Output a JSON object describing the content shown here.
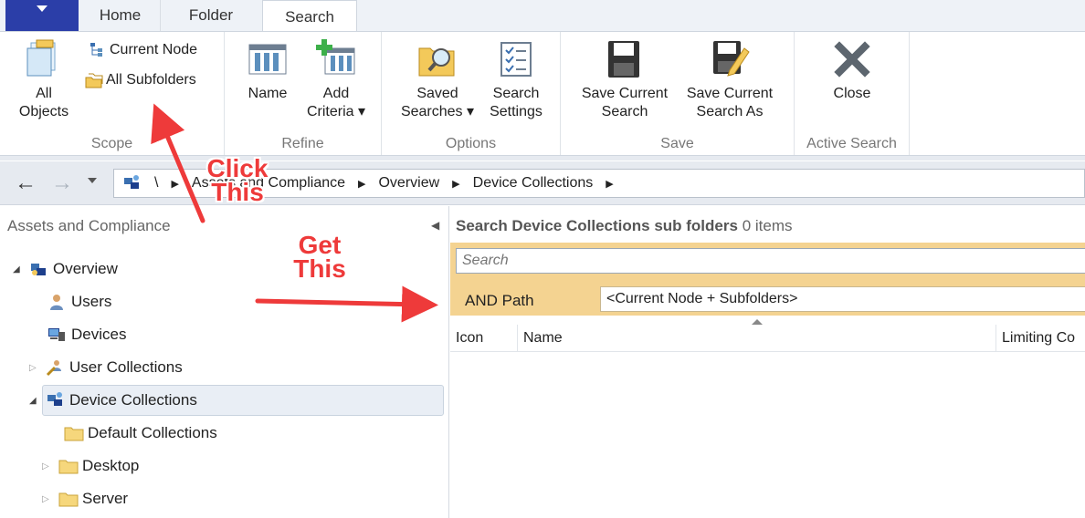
{
  "tabs": {
    "home": "Home",
    "folder": "Folder",
    "search": "Search"
  },
  "ribbon": {
    "scope": {
      "label": "Scope",
      "all_objects": "All\nObjects",
      "all_objects_l1": "All",
      "all_objects_l2": "Objects",
      "current_node": "Current Node",
      "all_subfolders": "All Subfolders"
    },
    "refine": {
      "label": "Refine",
      "name": "Name",
      "add_criteria_l1": "Add",
      "add_criteria_l2": "Criteria ▾"
    },
    "options": {
      "label": "Options",
      "saved_searches_l1": "Saved",
      "saved_searches_l2": "Searches ▾",
      "search_settings_l1": "Search",
      "search_settings_l2": "Settings"
    },
    "save": {
      "label": "Save",
      "save_current_l1": "Save Current",
      "save_current_l2": "Search",
      "save_as_l1": "Save Current",
      "save_as_l2": "Search As"
    },
    "active_search": {
      "label": "Active Search",
      "close": "Close"
    }
  },
  "address": {
    "root": "\\",
    "crumbs": [
      "Assets and Compliance",
      "Overview",
      "Device Collections"
    ]
  },
  "nav": {
    "title": "Assets and Compliance",
    "items": [
      {
        "label": "Overview"
      },
      {
        "label": "Users"
      },
      {
        "label": "Devices"
      },
      {
        "label": "User Collections"
      },
      {
        "label": "Device Collections"
      },
      {
        "label": "Default Collections"
      },
      {
        "label": "Desktop"
      },
      {
        "label": "Server"
      }
    ]
  },
  "results": {
    "title": "Search Device Collections sub folders",
    "count": "0 items",
    "search_placeholder": "Search",
    "and_path_label": "AND Path",
    "path_value": "<Current Node + Subfolders>",
    "columns": [
      "Icon",
      "Name",
      "Limiting Co"
    ]
  },
  "annotations": {
    "click_l1": "Click",
    "click_l2": "This",
    "get_l1": "Get",
    "get_l2": "This"
  },
  "colors": {
    "file_tab": "#2b3ea8",
    "search_strip": "#f4d391",
    "annotation": "#ee3a3a"
  }
}
